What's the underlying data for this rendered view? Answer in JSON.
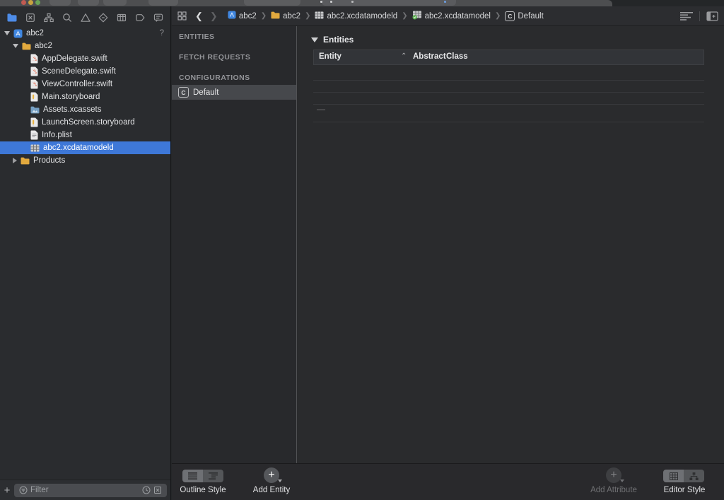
{
  "colors": {
    "selection_blue": "#3e78d8",
    "folder_yellow": "#e2a93e",
    "swift_orange": "#e4593c",
    "check_green": "#5cb250",
    "project_blue": "#3f86e0"
  },
  "navigator_bar": {
    "selected": "project-navigator",
    "icons": [
      "project-navigator",
      "source-control-navigator",
      "symbol-navigator",
      "find-navigator",
      "issue-navigator",
      "test-navigator",
      "debug-navigator",
      "breakpoint-navigator",
      "report-navigator"
    ]
  },
  "project_tree": {
    "items": [
      {
        "label": "abc2",
        "icon": "xcode-project-icon",
        "badge": "?",
        "depth": 0,
        "disclosure": "open"
      },
      {
        "label": "abc2",
        "icon": "folder-icon",
        "depth": 1,
        "disclosure": "open"
      },
      {
        "label": "AppDelegate.swift",
        "icon": "swift-file-icon",
        "depth": 2
      },
      {
        "label": "SceneDelegate.swift",
        "icon": "swift-file-icon",
        "depth": 2
      },
      {
        "label": "ViewController.swift",
        "icon": "swift-file-icon",
        "depth": 2
      },
      {
        "label": "Main.storyboard",
        "icon": "storyboard-file-icon",
        "depth": 2
      },
      {
        "label": "Assets.xcassets",
        "icon": "asset-catalog-icon",
        "depth": 2
      },
      {
        "label": "LaunchScreen.storyboard",
        "icon": "storyboard-file-icon",
        "depth": 2
      },
      {
        "label": "Info.plist",
        "icon": "plist-file-icon",
        "depth": 2
      },
      {
        "label": "abc2.xcdatamodeld",
        "icon": "datamodel-file-icon",
        "depth": 2,
        "selected": true
      },
      {
        "label": "Products",
        "icon": "folder-icon",
        "depth": 1,
        "disclosure": "closed"
      }
    ]
  },
  "filter_bar": {
    "placeholder": "Filter"
  },
  "jump_bar": {
    "breadcrumbs": [
      {
        "label": "abc2",
        "icon": "xcode-project-icon"
      },
      {
        "label": "abc2",
        "icon": "folder-icon"
      },
      {
        "label": "abc2.xcdatamodeld",
        "icon": "datamodel-file-icon"
      },
      {
        "label": "abc2.xcdatamodel",
        "icon": "datamodel-version-checked-icon"
      },
      {
        "label": "Default",
        "icon": "configuration-c-icon"
      }
    ]
  },
  "model_outline": {
    "sections": [
      {
        "title": "ENTITIES"
      },
      {
        "title": "FETCH REQUESTS"
      },
      {
        "title": "CONFIGURATIONS"
      }
    ],
    "configurations": [
      {
        "label": "Default",
        "selected": true
      }
    ]
  },
  "editor": {
    "group_title": "Entities",
    "table": {
      "columns": [
        "Entity",
        "Abstract",
        "Class"
      ],
      "rows": [],
      "empty_placeholder": "—"
    }
  },
  "bottom_bar": {
    "outline_style_label": "Outline Style",
    "add_entity_label": "Add Entity",
    "add_attribute_label": "Add Attribute",
    "editor_style_label": "Editor Style"
  }
}
